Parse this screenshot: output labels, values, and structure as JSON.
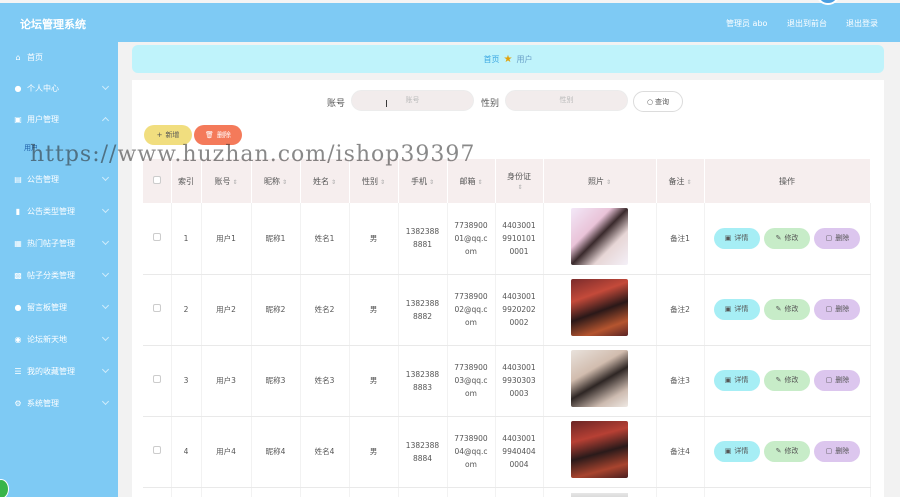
{
  "app": {
    "title": "论坛管理系统",
    "admin_label": "管理员 abo",
    "back_to_front": "退出到前台",
    "logout": "退出登录"
  },
  "sidebar": {
    "items": [
      {
        "label": "首页",
        "icon": "home-icon"
      },
      {
        "label": "个人中心",
        "icon": "person-icon"
      },
      {
        "label": "用户管理",
        "icon": "users-icon"
      },
      {
        "label": "公告管理",
        "icon": "notice-icon"
      },
      {
        "label": "公告类型管理",
        "icon": "bar-chart-icon"
      },
      {
        "label": "热门帖子管理",
        "icon": "doc-icon"
      },
      {
        "label": "帖子分类管理",
        "icon": "grid-icon"
      },
      {
        "label": "留言板管理",
        "icon": "person-icon"
      },
      {
        "label": "论坛新天地",
        "icon": "pin-icon"
      },
      {
        "label": "我的收藏管理",
        "icon": "list-icon"
      },
      {
        "label": "系统管理",
        "icon": "gear-icon"
      }
    ],
    "sub_active": "用户"
  },
  "breadcrumb": {
    "home": "首页",
    "current": "用户"
  },
  "search": {
    "account_label": "账号",
    "account_placeholder": "账号",
    "gender_label": "性别",
    "gender_placeholder": "性别",
    "query_label": "查询"
  },
  "toolbar": {
    "add_label": "新增",
    "delete_label": "删除"
  },
  "watermark": "https://www.huzhan.com/ishop39397",
  "table": {
    "columns": [
      "索引",
      "账号",
      "昵称",
      "姓名",
      "性别",
      "手机",
      "邮箱",
      "身份证",
      "照片",
      "备注",
      "操作"
    ],
    "rows": [
      {
        "index": "1",
        "account": "用户1",
        "nickname": "昵称1",
        "name": "姓名1",
        "gender": "男",
        "phone": [
          "1382388",
          "8881"
        ],
        "email": [
          "7738900",
          "01@qq.c",
          "om"
        ],
        "id_card": [
          "4403001",
          "9910101",
          "0001"
        ],
        "remark": "备注1"
      },
      {
        "index": "2",
        "account": "用户2",
        "nickname": "昵称2",
        "name": "姓名2",
        "gender": "男",
        "phone": [
          "1382388",
          "8882"
        ],
        "email": [
          "7738900",
          "02@qq.c",
          "om"
        ],
        "id_card": [
          "4403001",
          "9920202",
          "0002"
        ],
        "remark": "备注2"
      },
      {
        "index": "3",
        "account": "用户3",
        "nickname": "昵称3",
        "name": "姓名3",
        "gender": "男",
        "phone": [
          "1382388",
          "8883"
        ],
        "email": [
          "7738900",
          "03@qq.c",
          "om"
        ],
        "id_card": [
          "4403001",
          "9930303",
          "0003"
        ],
        "remark": "备注3"
      },
      {
        "index": "4",
        "account": "用户4",
        "nickname": "昵称4",
        "name": "姓名4",
        "gender": "男",
        "phone": [
          "1382388",
          "8884"
        ],
        "email": [
          "7738900",
          "04@qq.c",
          "om"
        ],
        "id_card": [
          "4403001",
          "9940404",
          "0004"
        ],
        "remark": "备注4"
      }
    ],
    "actions": {
      "detail": "详情",
      "edit": "修改",
      "remove": "删除"
    }
  },
  "colors": {
    "sidebar_bg": "#7ecaf4",
    "breadcrumb_bg": "#bff3fb",
    "add_button": "#f1de7f",
    "delete_button": "#f47a5a",
    "detail_button": "#a6eef5",
    "edit_button": "#c7ecc8",
    "remove_button": "#dcc6ee",
    "table_header": "#f6eeee"
  }
}
